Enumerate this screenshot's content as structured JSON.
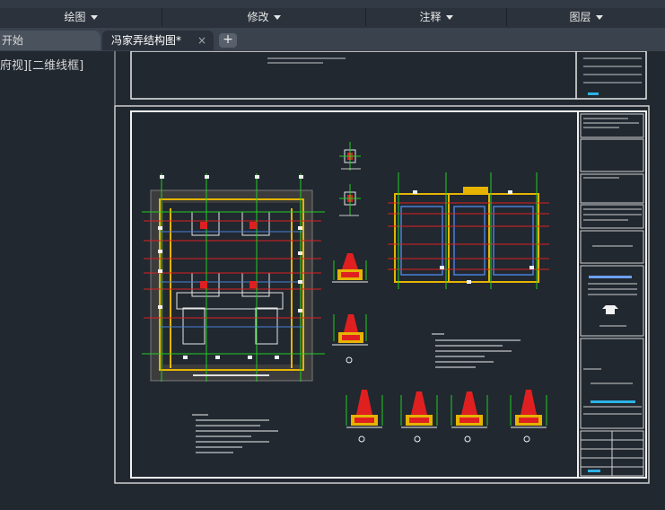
{
  "ribbon": {
    "panels": [
      {
        "label": "绘图"
      },
      {
        "label": "修改"
      },
      {
        "label": "注释"
      },
      {
        "label": "图层"
      }
    ]
  },
  "tabs": {
    "start": "开始",
    "active": "冯家弄结构图*",
    "close_glyph": "×",
    "add_glyph": "+"
  },
  "viewport": {
    "view_label": "府视][二维线框]"
  },
  "colors": {
    "model_bg": "#212830",
    "sheet_border": "#e8e8e8",
    "axis_red": "#e02020",
    "wall_yellow": "#e6b400",
    "dim_green": "#22cc22",
    "beam_blue": "#4a7fd8",
    "note_white": "#f0f0f0"
  }
}
